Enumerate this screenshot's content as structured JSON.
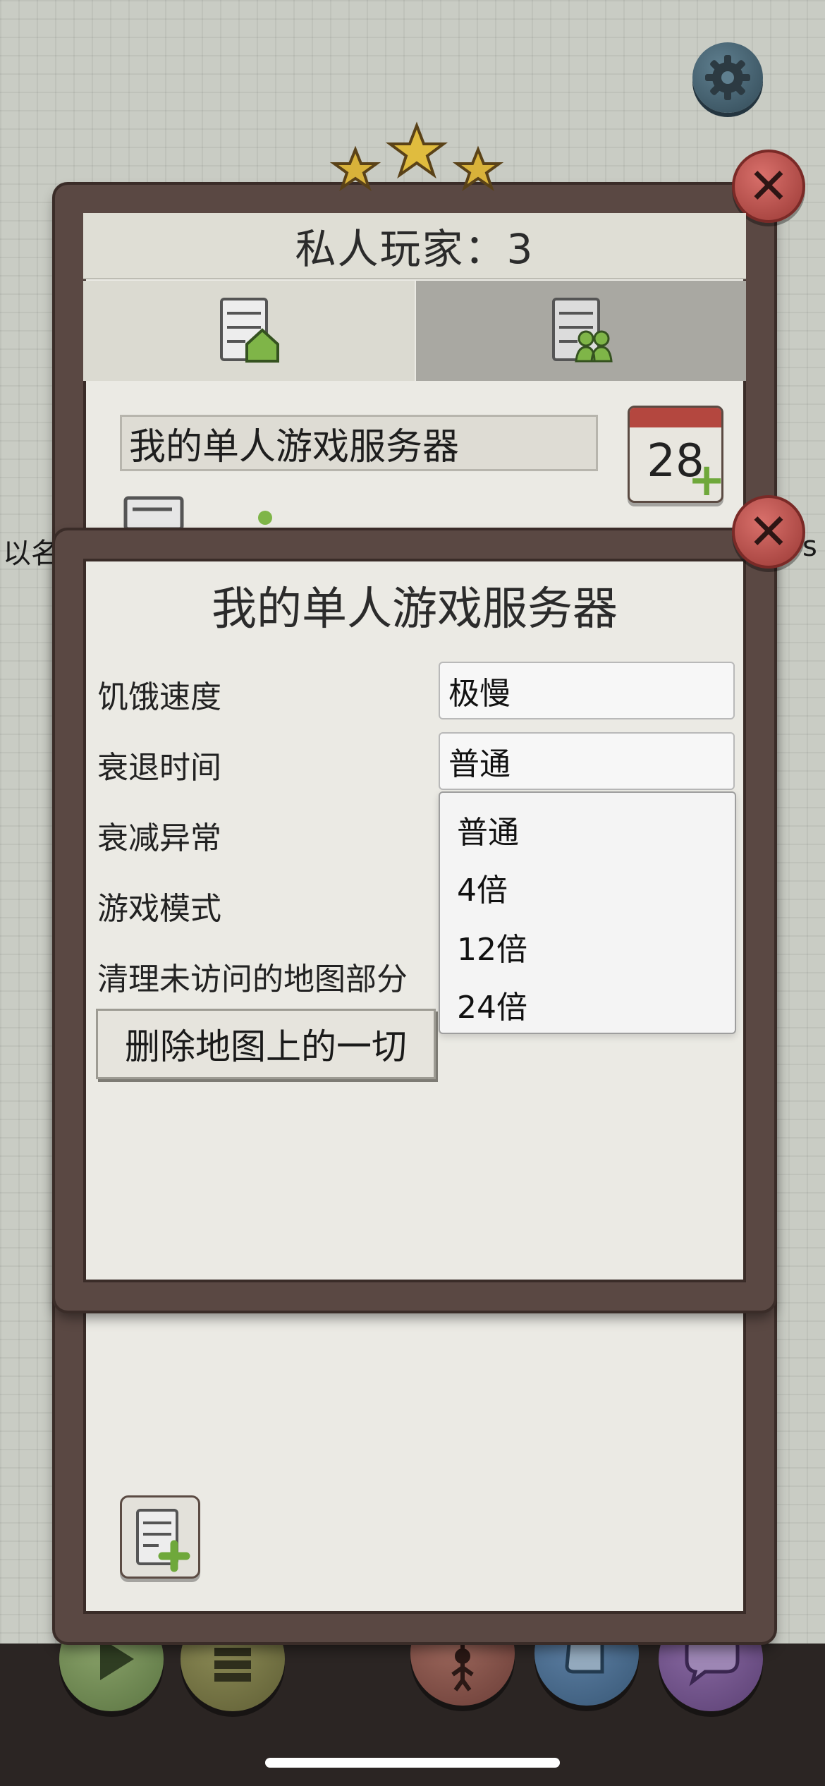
{
  "background_panel": {
    "title": "私人玩家：3",
    "server_name": "我的单人游戏服务器",
    "calendar_day": "28"
  },
  "side_text": {
    "left": "以名",
    "right": "s"
  },
  "dialog": {
    "title": "我的单人游戏服务器",
    "settings": [
      {
        "label": "饥饿速度",
        "value": "极慢"
      },
      {
        "label": "衰退时间",
        "value": "普通"
      },
      {
        "label": "衰减异常"
      },
      {
        "label": "游戏模式"
      },
      {
        "label": "清理未访问的地图部分"
      }
    ],
    "dropdown_options": [
      "普通",
      "4倍",
      "12倍",
      "24倍"
    ],
    "delete_button": "删除地图上的一切"
  },
  "colors": {
    "wood_frame": "#5a4843",
    "close_red": "#b24a45",
    "accent_green": "#6fa83b",
    "settings_blue": "#415f6e"
  },
  "icons": [
    "gear-icon",
    "star-icon",
    "close-icon",
    "server-home-icon",
    "server-group-icon",
    "calendar-add-icon",
    "server-add-icon",
    "play-icon",
    "list-icon",
    "puppet-icon",
    "scroll-icon",
    "chat-icon"
  ]
}
